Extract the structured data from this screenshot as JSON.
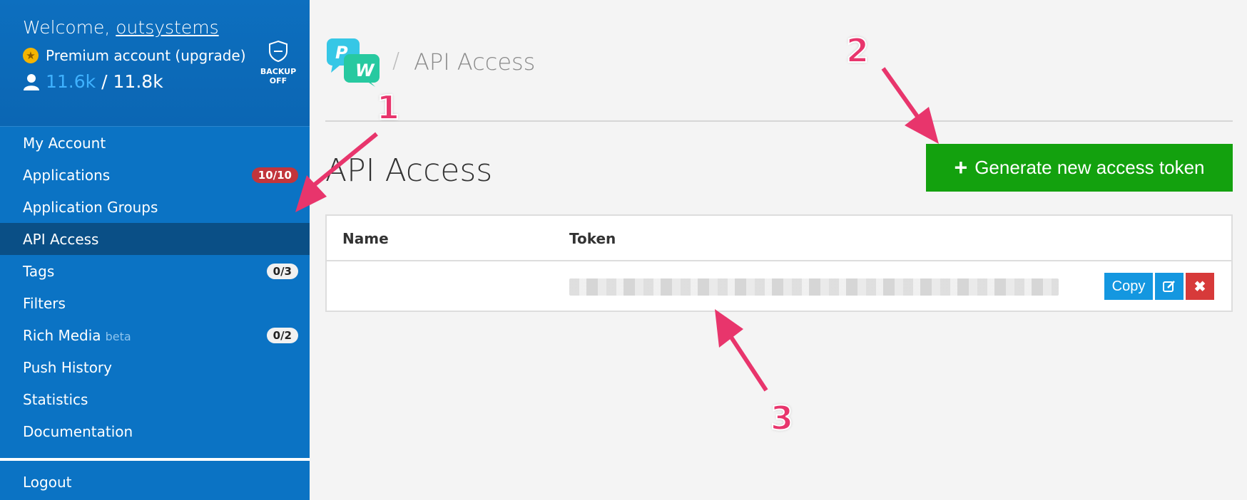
{
  "sidebar": {
    "welcome_prefix": "Welcome,",
    "username": "outsystems",
    "premium_text": "Premium account (upgrade)",
    "count_used": "11.6k",
    "count_total": "/ 11.8k",
    "backup_label_1": "BACKUP",
    "backup_label_2": "OFF",
    "items": [
      {
        "label": "My Account"
      },
      {
        "label": "Applications",
        "badge": "10/10"
      },
      {
        "label": "Application Groups"
      },
      {
        "label": "API Access"
      },
      {
        "label": "Tags",
        "badge": "0/3"
      },
      {
        "label": "Filters"
      },
      {
        "label": "Rich Media",
        "suffix": "beta",
        "badge": "0/2"
      },
      {
        "label": "Push History"
      },
      {
        "label": "Statistics"
      },
      {
        "label": "Documentation"
      }
    ],
    "logout": "Logout"
  },
  "header": {
    "breadcrumb_sep": "/",
    "breadcrumb": "API Access",
    "logo_letters": [
      "P",
      "W"
    ]
  },
  "main": {
    "title": "API Access",
    "generate_button": "Generate new access token",
    "table": {
      "columns": [
        "Name",
        "Token"
      ],
      "actions": {
        "copy": "Copy",
        "edit_icon": "edit-icon",
        "delete_icon": "close-icon"
      }
    }
  },
  "annotations": [
    "1",
    "2",
    "3"
  ],
  "colors": {
    "sidebar": "#0b73c4",
    "sidebar_active": "#0a4f86",
    "generate_button": "#13a10e",
    "copy_button": "#1497e0",
    "delete_button": "#d73a3a",
    "annotation": "#e8356c"
  }
}
